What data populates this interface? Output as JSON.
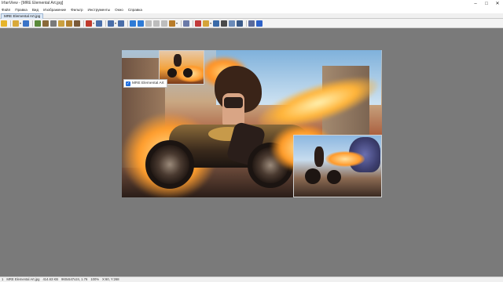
{
  "window": {
    "title": "IrfanView - [MRE Elemental Art.jpg]",
    "minimize": "–",
    "maximize": "□",
    "close": "✕"
  },
  "menu": {
    "items": [
      "Файл",
      "Правка",
      "Вид",
      "Изображение",
      "Фильтр",
      "Инструменты",
      "Окно",
      "Справка"
    ]
  },
  "tabs": [
    {
      "label": "MRE Elemental Art.jpg"
    }
  ],
  "toolbar": {
    "buttons": [
      {
        "icon": "yellow-square-icon",
        "color": "#e6b42a"
      },
      {
        "icon": "open-folder-icon",
        "color": "#d9a93a"
      },
      {
        "icon": "save-icon",
        "color": "#3a74c8"
      },
      {
        "icon": "slideshow-icon",
        "color": "#5a8a3a"
      },
      {
        "icon": "scan-icon",
        "color": "#8a6a3a"
      },
      {
        "icon": "print-icon",
        "color": "#7a7a7a"
      },
      {
        "icon": "copy-icon",
        "color": "#caa040"
      },
      {
        "icon": "paste-icon",
        "color": "#b08030"
      },
      {
        "icon": "cut-icon",
        "color": "#7a5a3a"
      },
      {
        "icon": "delete-icon",
        "color": "#c0392b"
      },
      {
        "icon": "zoom-in-icon",
        "color": "#4a6ea8"
      },
      {
        "icon": "zoom-out-icon",
        "color": "#4a6ea8"
      },
      {
        "icon": "previous-icon",
        "color": "#2e7bd6"
      },
      {
        "icon": "next-icon",
        "color": "#2e7bd6"
      },
      {
        "icon": "rotate-left-icon",
        "color": "#9a9a9a"
      },
      {
        "icon": "rotate-right-icon",
        "color": "#9a9a9a"
      },
      {
        "icon": "flip-icon",
        "color": "#9a9a9a"
      },
      {
        "icon": "crop-icon",
        "color": "#b87c2a"
      },
      {
        "icon": "properties-icon",
        "color": "#6a7aa8"
      },
      {
        "icon": "thumbnails-icon",
        "color": "#c23a3a"
      },
      {
        "icon": "folder-browse-icon",
        "color": "#d4a43a"
      },
      {
        "icon": "filmstrip-icon",
        "color": "#3a6aa8"
      },
      {
        "icon": "camera-icon",
        "color": "#4a4a4a"
      },
      {
        "icon": "email-icon",
        "color": "#6a8ab8"
      },
      {
        "icon": "settings-icon",
        "color": "#5a6a9a"
      },
      {
        "icon": "info-icon",
        "color": "#2e62c8"
      }
    ]
  },
  "overlay": {
    "checked": "✓",
    "label": "MRE Elemental Art"
  },
  "statusbar": {
    "index": "1",
    "filename": "MRE Elemental Art.jpg",
    "filesize": "414.63 KB",
    "dimensions": "960x547x24, 1.76",
    "zoom": "100%",
    "coords": "X:60, Y:268"
  }
}
